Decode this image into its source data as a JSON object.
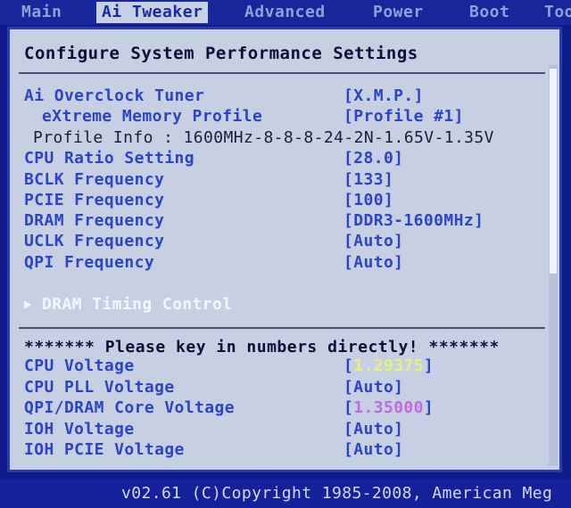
{
  "tabs": [
    {
      "label": "Main"
    },
    {
      "label": "Ai Tweaker"
    },
    {
      "label": "Advanced"
    },
    {
      "label": "Power"
    },
    {
      "label": "Boot"
    },
    {
      "label": "Tools"
    }
  ],
  "panel": {
    "title": "Configure System Performance Settings",
    "settings": [
      {
        "label": "Ai Overclock Tuner",
        "value": "[X.M.P.]"
      },
      {
        "label": "eXtreme Memory Profile",
        "value": "[Profile #1]"
      },
      {
        "label": "Profile Info : 1600MHz-8-8-8-24-2N-1.65V-1.35V"
      },
      {
        "label": "CPU Ratio Setting",
        "value": "[28.0]"
      },
      {
        "label": "BCLK Frequency",
        "value": "[133]"
      },
      {
        "label": "PCIE Frequency",
        "value": "[100]"
      },
      {
        "label": "DRAM Frequency",
        "value": "[DDR3-1600MHz]"
      },
      {
        "label": "UCLK Frequency",
        "value": "[Auto]"
      },
      {
        "label": "QPI Frequency",
        "value": "[Auto]"
      }
    ],
    "submenu": "DRAM Timing Control",
    "notice": "******* Please key in numbers directly! *******",
    "voltages": [
      {
        "label": "CPU Voltage",
        "value": "1.29375",
        "bracket_left": "[",
        "bracket_right": "]",
        "color": "#e6f07a"
      },
      {
        "label": "CPU PLL Voltage",
        "value": "[Auto]"
      },
      {
        "label": "QPI/DRAM Core Voltage",
        "value": "1.35000",
        "bracket_left": "[",
        "bracket_right": "]",
        "color": "#c06ae0"
      },
      {
        "label": "IOH Voltage",
        "value": "[Auto]"
      },
      {
        "label": "IOH PCIE Voltage",
        "value": "[Auto]"
      }
    ]
  },
  "footer": {
    "text": "v02.61 (C)Copyright 1985-2008, American Meg"
  },
  "colors": {
    "background": "#0d1c8a",
    "panel": "#c7d0e2",
    "label": "#2b44c8",
    "accent_highlight": "#e6f07a",
    "accent_purple": "#c06ae0"
  },
  "icons": {
    "submenu_arrow": "triangle-right-icon"
  }
}
